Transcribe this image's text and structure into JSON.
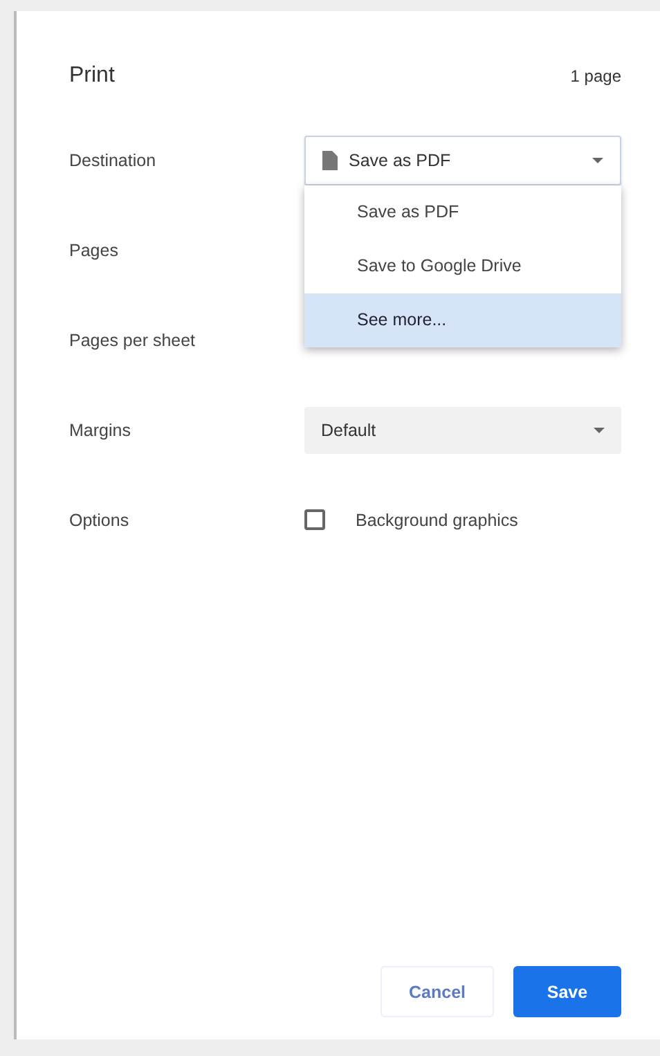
{
  "dialog": {
    "title": "Print",
    "page_count": "1 page"
  },
  "settings": [
    {
      "label": "Destination",
      "kind": "file-select",
      "value": "Save as PDF",
      "open": true
    },
    {
      "label": "Pages",
      "kind": "hidden"
    },
    {
      "label": "Pages per sheet",
      "kind": "hidden"
    },
    {
      "label": "Margins",
      "kind": "select",
      "value": "Default",
      "open": false
    },
    {
      "label": "Options",
      "kind": "checkbox",
      "value": "Background graphics",
      "checked": false
    }
  ],
  "menu": [
    {
      "label": "Save as PDF",
      "selected": false
    },
    {
      "label": "Save to Google Drive",
      "selected": false
    },
    {
      "label": "See more...",
      "selected": true
    }
  ],
  "buttons": [
    {
      "label": "Cancel",
      "kind": "secondary"
    },
    {
      "label": "Save",
      "kind": "primary"
    }
  ]
}
